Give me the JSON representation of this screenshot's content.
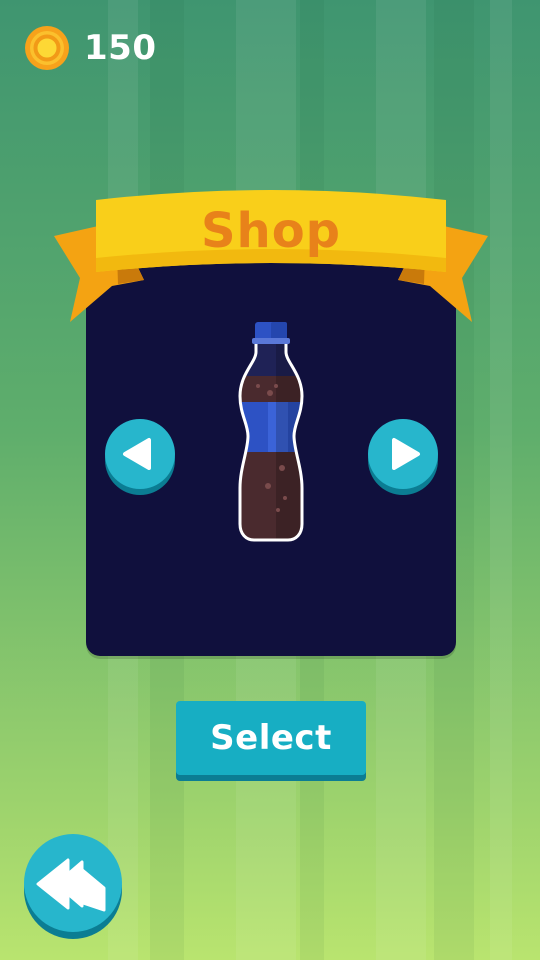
{
  "hud": {
    "coin_icon": "gold-coin-icon",
    "coin_count": "150"
  },
  "shop": {
    "title": "Shop",
    "selected_item": {
      "icon": "cola-bottle-icon",
      "colors": {
        "cap": "#2d52c4",
        "label": "#2d52c4",
        "liquid": "#4a2a2e",
        "outline": "#ffffff"
      }
    },
    "prev_icon": "chevron-left-icon",
    "next_icon": "chevron-right-icon"
  },
  "actions": {
    "select_label": "Select",
    "back_icon": "double-arrow-back-icon"
  },
  "colors": {
    "panel": "#10103d",
    "ribbon": "#f5c518",
    "ribbon_text": "#e8821a",
    "button": "#17aec3",
    "button_shadow": "#0b7d93",
    "background_top": "#3f9570",
    "background_bottom": "#b9e46f"
  }
}
